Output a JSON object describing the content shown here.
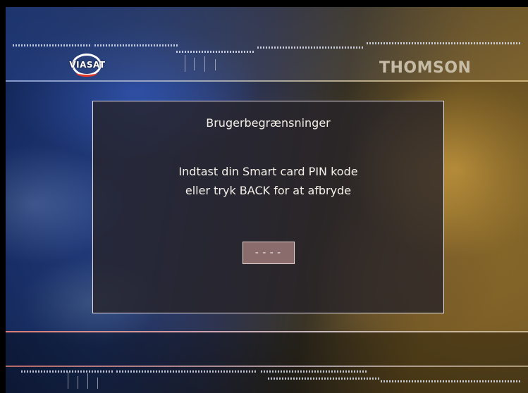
{
  "header": {
    "left_logo_text": "VIASAT",
    "right_logo_text": "THOMSON"
  },
  "dialog": {
    "title": "Brugerbegrænsninger",
    "message_line_1": "Indtast din Smart card PIN kode",
    "message_line_2": "eller tryk BACK for at afbryde",
    "pin_value": "----"
  },
  "colors": {
    "viasat_accent": "#e23a2a",
    "dialog_border": "#e8e0e8",
    "pin_box_fill": "#8a6c6c"
  }
}
